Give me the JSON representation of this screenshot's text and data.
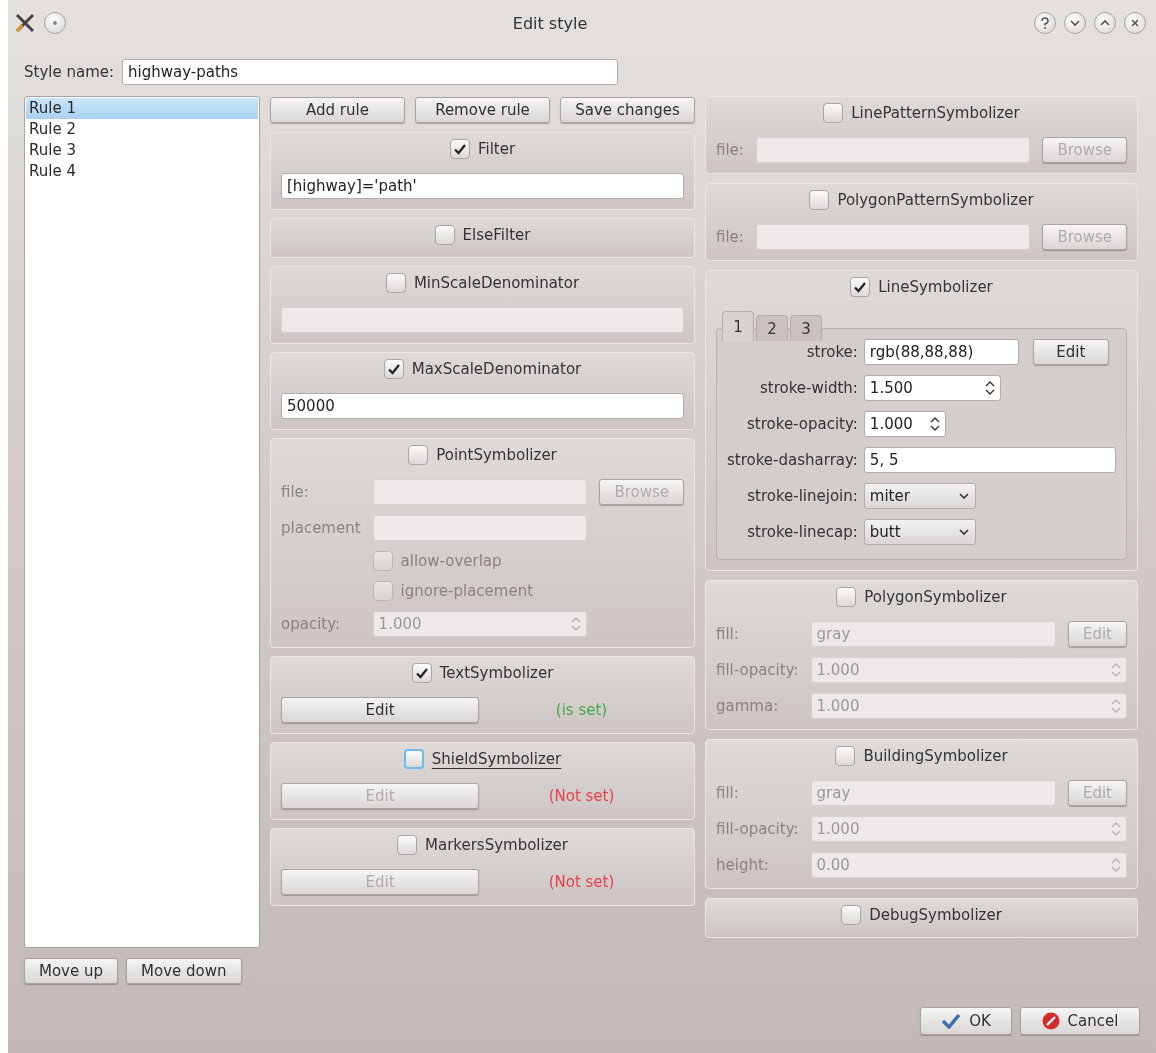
{
  "window": {
    "title": "Edit style"
  },
  "style_name": {
    "label": "Style name:",
    "value": "highway-paths"
  },
  "rules": [
    {
      "label": "Rule 1",
      "selected": true
    },
    {
      "label": "Rule 2",
      "selected": false
    },
    {
      "label": "Rule 3",
      "selected": false
    },
    {
      "label": "Rule 4",
      "selected": false
    }
  ],
  "rule_buttons": [
    "Move up",
    "Move down"
  ],
  "toolbar_buttons": [
    "Add rule",
    "Remove rule",
    "Save changes"
  ],
  "middle_sections": [
    {
      "title": "Filter",
      "checked": true,
      "focused": false,
      "rows": [
        {
          "kind": "text",
          "value": "[highway]='path'"
        }
      ]
    },
    {
      "title": "ElseFilter",
      "checked": false,
      "focused": false
    },
    {
      "title": "MinScaleDenominator",
      "checked": false,
      "focused": false,
      "rows": [
        {
          "kind": "text",
          "value": ""
        }
      ]
    },
    {
      "title": "MaxScaleDenominator",
      "checked": true,
      "focused": false,
      "rows": [
        {
          "kind": "text",
          "value": "50000"
        }
      ]
    },
    {
      "title": "PointSymbolizer",
      "checked": false,
      "focused": false,
      "rows": [
        {
          "kind": "file",
          "label": "file:",
          "value": "",
          "button": "Browse"
        },
        {
          "kind": "field",
          "label": "placement",
          "value": ""
        },
        {
          "kind": "checkbox",
          "label": "allow-overlap",
          "checked": false
        },
        {
          "kind": "checkbox",
          "label": "ignore-placement",
          "checked": false
        },
        {
          "kind": "spin",
          "label": "opacity:",
          "value": "1.000"
        }
      ]
    },
    {
      "title": "TextSymbolizer",
      "checked": true,
      "focused": false,
      "rows": [
        {
          "kind": "edit",
          "button": "Edit",
          "status": "(is set)",
          "set": true
        }
      ]
    },
    {
      "title": "ShieldSymbolizer",
      "checked": false,
      "focused": true,
      "rows": [
        {
          "kind": "edit",
          "button": "Edit",
          "status": "(Not set)",
          "set": false
        }
      ]
    },
    {
      "title": "MarkersSymbolizer",
      "checked": false,
      "focused": false,
      "rows": [
        {
          "kind": "edit",
          "button": "Edit",
          "status": "(Not set)",
          "set": false
        }
      ]
    }
  ],
  "right_sections": [
    {
      "title": "LinePatternSymbolizer",
      "checked": false,
      "focused": false,
      "rows": [
        {
          "kind": "file",
          "label": "file:",
          "value": "",
          "button": "Browse"
        }
      ]
    },
    {
      "title": "PolygonPatternSymbolizer",
      "checked": false,
      "focused": false,
      "rows": [
        {
          "kind": "file",
          "label": "file:",
          "value": "",
          "button": "Browse"
        }
      ]
    },
    {
      "title": "LineSymbolizer",
      "checked": true,
      "focused": false,
      "tabs": [
        {
          "label": "1",
          "selected": true
        },
        {
          "label": "2",
          "selected": false
        },
        {
          "label": "3",
          "selected": false
        }
      ],
      "rows": [
        {
          "kind": "color",
          "label": "stroke:",
          "value": "rgb(88,88,88)",
          "button": "Edit"
        },
        {
          "kind": "spin",
          "label": "stroke-width:",
          "value": "1.500"
        },
        {
          "kind": "spin",
          "label": "stroke-opacity:",
          "value": "1.000"
        },
        {
          "kind": "text",
          "label": "stroke-dasharray:",
          "value": "5, 5"
        },
        {
          "kind": "select",
          "label": "stroke-linejoin:",
          "value": "miter"
        },
        {
          "kind": "select",
          "label": "stroke-linecap:",
          "value": "butt"
        }
      ]
    },
    {
      "title": "PolygonSymbolizer",
      "checked": false,
      "focused": false,
      "rows": [
        {
          "kind": "file",
          "label": "fill:",
          "value": "gray",
          "button": "Edit"
        },
        {
          "kind": "spin",
          "label": "fill-opacity:",
          "value": "1.000"
        },
        {
          "kind": "spin",
          "label": "gamma:",
          "value": "1.000"
        }
      ]
    },
    {
      "title": "BuildingSymbolizer",
      "checked": false,
      "focused": false,
      "rows": [
        {
          "kind": "file",
          "label": "fill:",
          "value": "gray",
          "button": "Edit"
        },
        {
          "kind": "spin",
          "label": "fill-opacity:",
          "value": "1.000"
        },
        {
          "kind": "spin",
          "label": "height:",
          "value": "0.00"
        }
      ]
    },
    {
      "title": "DebugSymbolizer",
      "checked": false,
      "focused": false
    }
  ],
  "dialog_buttons": [
    {
      "kind": "ok",
      "label": "OK"
    },
    {
      "kind": "cancel",
      "label": "Cancel"
    }
  ]
}
